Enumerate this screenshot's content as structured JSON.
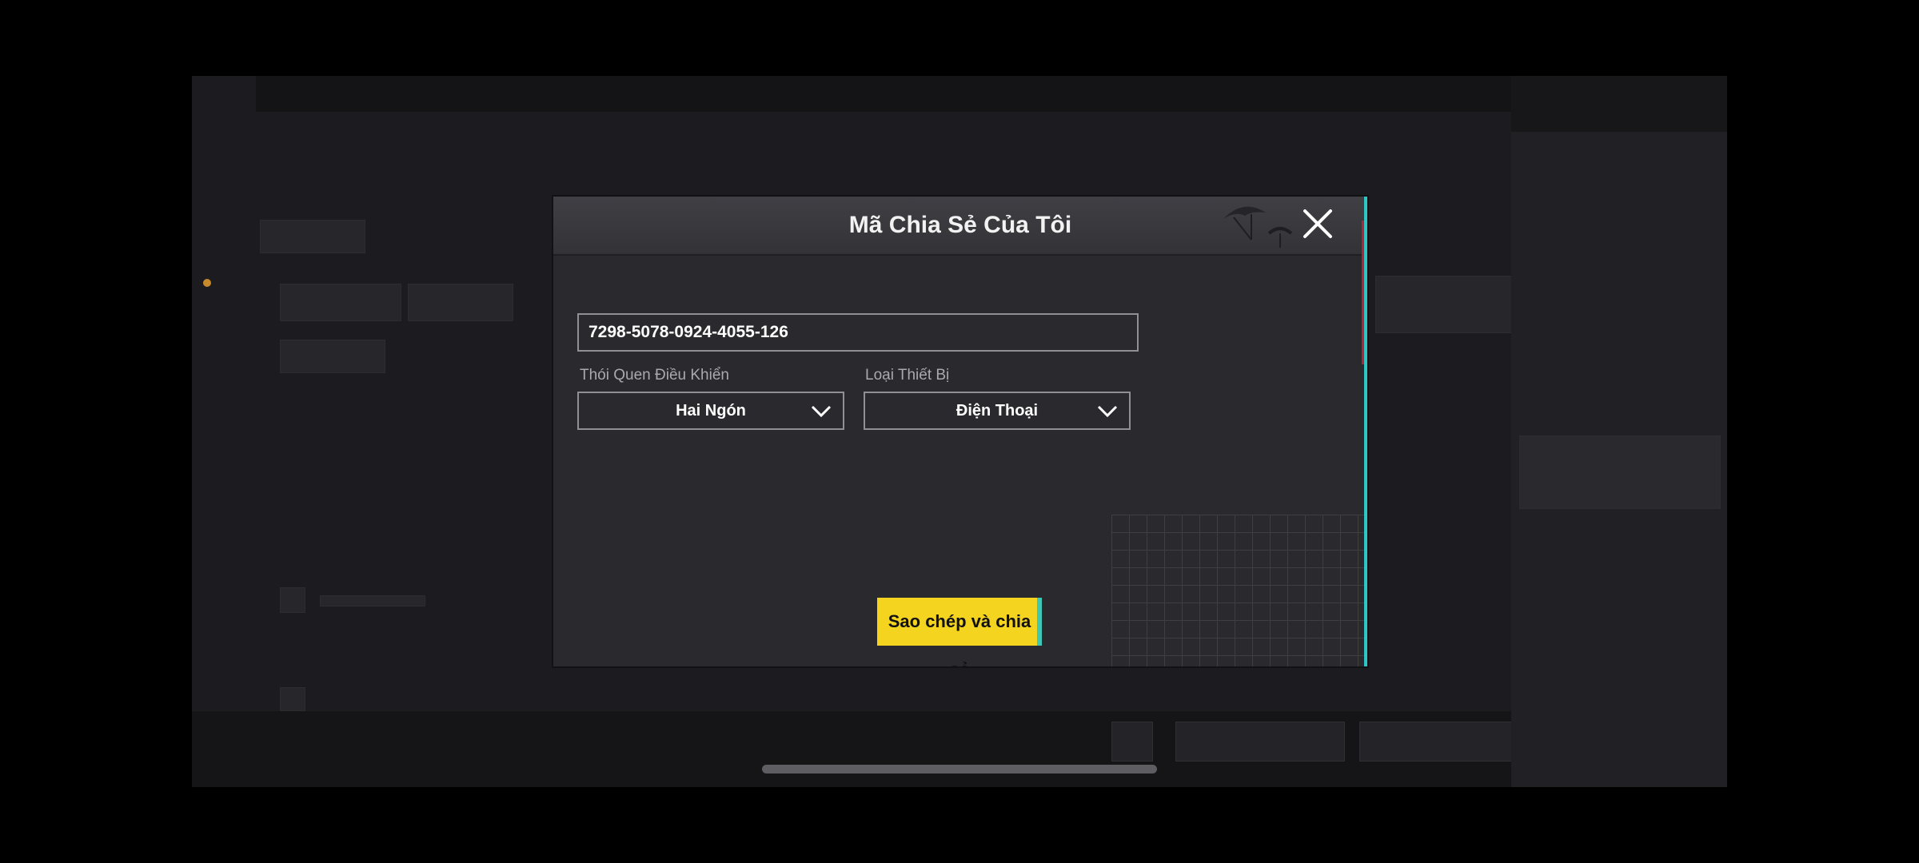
{
  "modal": {
    "title": "Mã Chia Sẻ Của Tôi",
    "share_code": "7298-5078-0924-4055-126",
    "control_habit_label": "Thói Quen Điều Khiển",
    "control_habit_value": "Hai Ngón",
    "device_type_label": "Loại Thiết Bị",
    "device_type_value": "Điện Thoại",
    "copy_share_button": "Sao chép và chia sẻ",
    "close_icon": "close-icon",
    "dropdown_icon": "chevron-down-icon"
  },
  "colors": {
    "button_yellow": "#f4d41f",
    "modal_bg": "#2a2a2e",
    "accent_cyan": "#2fc5c5"
  }
}
